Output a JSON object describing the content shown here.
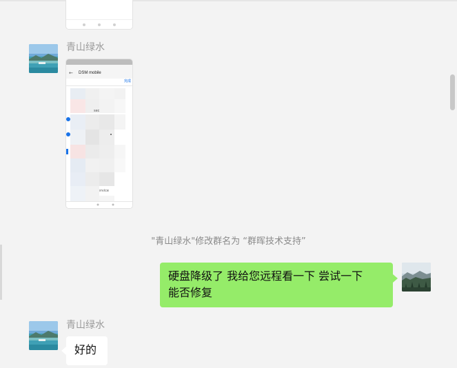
{
  "messages": [
    {
      "type": "image",
      "sender": "",
      "partial": true
    },
    {
      "type": "image",
      "sender": "青山绿水",
      "preview_title": "DSM mobile",
      "preview_action": "完成",
      "preview_text_a": "sec",
      "preview_text_b": "service"
    },
    {
      "type": "system",
      "text": "\"青山绿水\"修改群名为 “群晖技术支持”"
    },
    {
      "type": "text",
      "direction": "outgoing",
      "line1": "硬盘降级了  我给您远程看一下 尝试一下",
      "line2": "能否修复"
    },
    {
      "type": "text",
      "direction": "incoming",
      "sender": "青山绿水",
      "text": "好的"
    }
  ],
  "colors": {
    "background": "#f3f3f3",
    "outgoing_bubble": "#95ec69",
    "incoming_bubble": "#ffffff",
    "sender_name": "#9a9a9a",
    "system_text": "#8a8a8a"
  },
  "icons": [
    "avatar-landscape-lake",
    "avatar-forest-mountain"
  ]
}
